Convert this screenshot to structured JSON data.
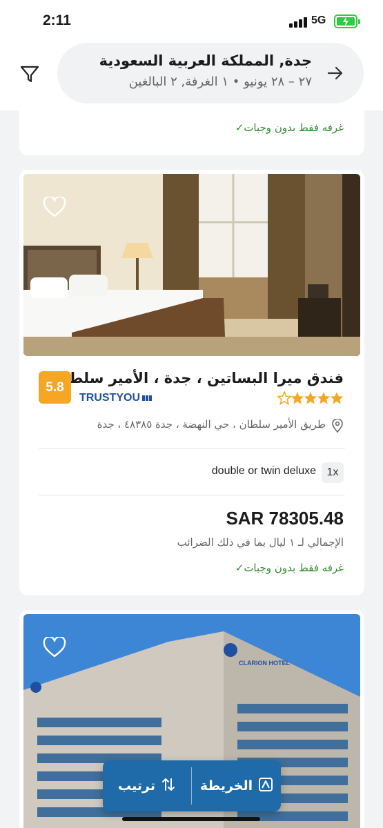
{
  "status_bar": {
    "time": "2:11",
    "network": "5G"
  },
  "header": {
    "destination": "جدة, المملكة العربية السعودية",
    "details": "٢٧ – ٢٨ يونيو • ١ الغرفة, ٢ البالغين",
    "icons": {
      "filter": "filter-icon",
      "back": "arrow-right-icon"
    }
  },
  "previous_card": {
    "meal_plan": "غرفه فقط بدون وجبات"
  },
  "hotel": {
    "name": "فندق ميرا البساتين ، جدة ، الأمير سلطان",
    "score": "5.8",
    "review_provider": "TRUSTYOU",
    "stars": 4,
    "address": "طريق الأمير سلطان ، حي النهضة ، جدة ٤٨٣٨٥ ، جدة",
    "room_qty": "1x",
    "room_name": "double or twin deluxe",
    "price": "SAR 78305.48",
    "price_note": "الإجمالي لـ ١ ليال بما في ذلك الضرائب",
    "meal_plan": "غرفه فقط بدون وجبات"
  },
  "next_hotel": {
    "sign_text": "CLARION HOTEL"
  },
  "actions": {
    "map_label": "الخريطة",
    "sort_label": "ترتيب"
  },
  "colors": {
    "accent": "#1f6aa8",
    "score": "#f5a623",
    "meal_green": "#2e8b2e",
    "star": "#f5a623"
  }
}
